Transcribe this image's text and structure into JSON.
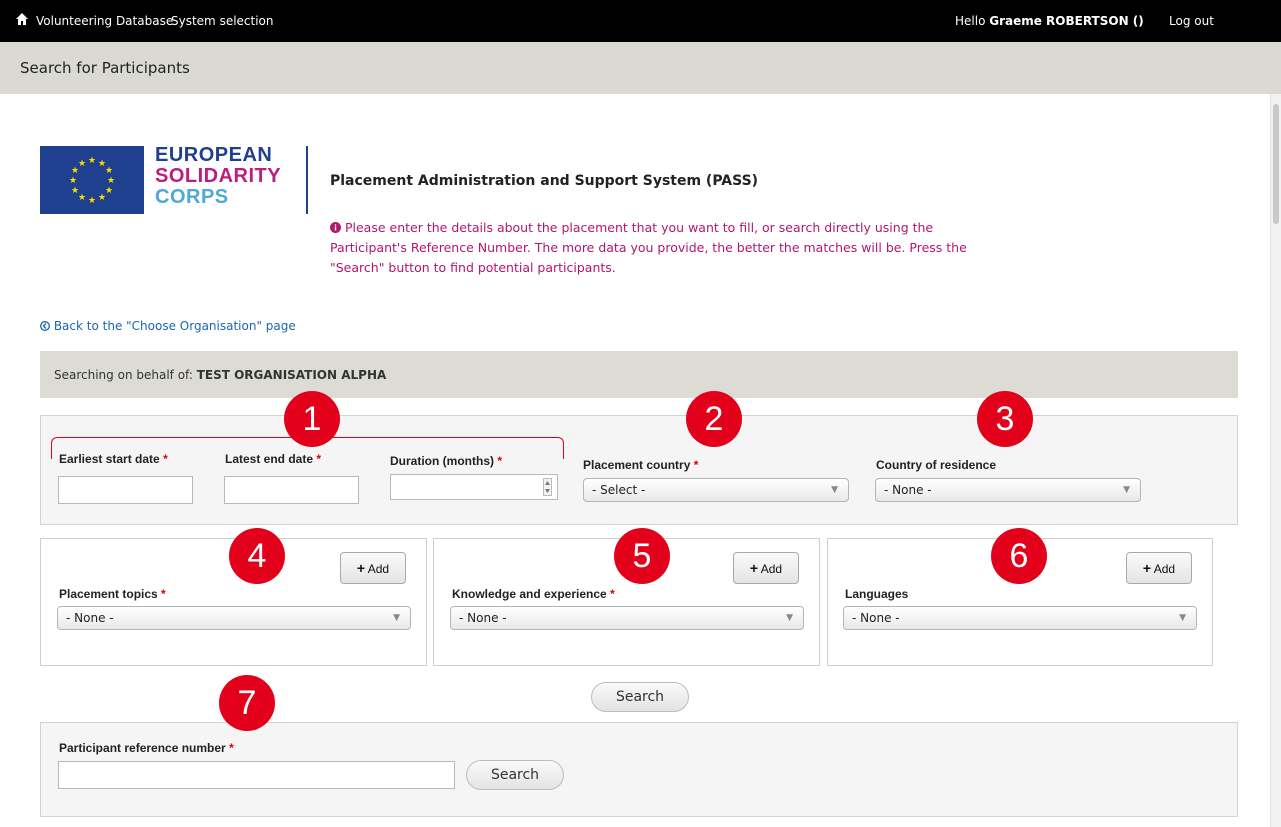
{
  "topbar": {
    "home_icon": "home-icon",
    "nav": [
      "Volunteering Database",
      "System selection"
    ],
    "hello_prefix": "Hello ",
    "user": "Graeme ROBERTSON ()",
    "logout": "Log out"
  },
  "page_title": "Search for Participants",
  "brand": {
    "line1": "EUROPEAN",
    "line2": "SOLIDARITY",
    "line3": "CORPS",
    "colors": {
      "blue": "#1f3f8f",
      "magenta": "#bb1e7f",
      "light_blue": "#4fa8d8"
    }
  },
  "system_title": "Placement Administration and Support System (PASS)",
  "info_text": "Please enter the details about the placement that you want to fill, or search directly using the Participant's Reference Number. The more data you provide, the better the matches will be. Press the \"Search\" button to find potential participants.",
  "back_link": "Back to the \"Choose Organisation\" page",
  "behalf": {
    "label": "Searching on behalf of: ",
    "org": "TEST ORGANISATION ALPHA"
  },
  "fields": {
    "earliest_start": "Earliest start date",
    "latest_end": "Latest end date",
    "duration": "Duration (months)",
    "placement_country": "Placement country",
    "country_residence": "Country of residence",
    "placement_topics": "Placement topics",
    "knowledge": "Knowledge and experience",
    "languages": "Languages",
    "participant_ref": "Participant reference number",
    "required_mark": "*"
  },
  "selects": {
    "placement_country": "- Select -",
    "country_residence": "- None -",
    "placement_topics": "- None -",
    "knowledge": "- None -",
    "languages": "- None -"
  },
  "buttons": {
    "add": "Add",
    "search": "Search"
  },
  "badges": [
    "1",
    "2",
    "3",
    "4",
    "5",
    "6",
    "7"
  ],
  "colors": {
    "badge_red": "#e2001a",
    "info_magenta": "#b0176f",
    "link_blue": "#1a66b0"
  }
}
